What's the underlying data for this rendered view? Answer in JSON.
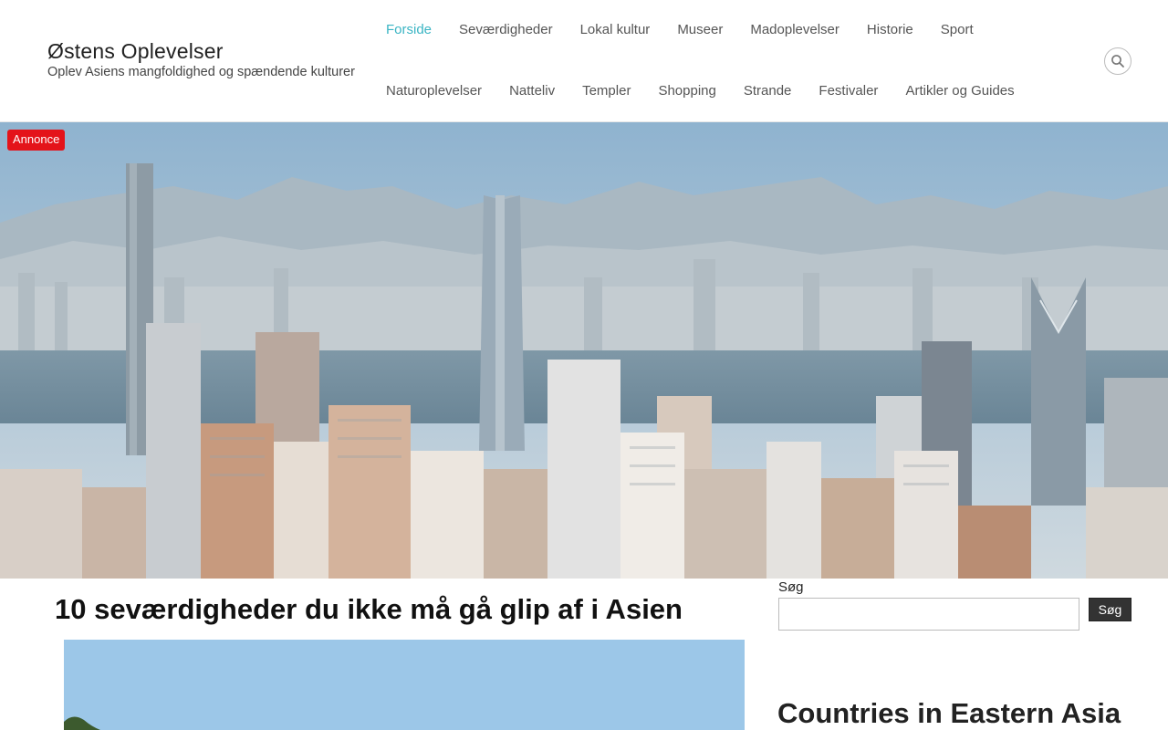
{
  "header": {
    "site_title": "Østens Oplevelser",
    "tagline": "Oplev Asiens mangfoldighed og spændende kulturer",
    "nav_row1": [
      "Forside",
      "Seværdigheder",
      "Lokal kultur",
      "Museer",
      "Madoplevelser",
      "Historie",
      "Sport"
    ],
    "nav_row2": [
      "Naturoplevelser",
      "Natteliv",
      "Templer",
      "Shopping",
      "Strande",
      "Festivaler",
      "Artikler og Guides"
    ],
    "active_item": "Forside",
    "search_icon": "search-icon"
  },
  "hero": {
    "ad_label": "Annonce",
    "image_subject": "city-skyline"
  },
  "main": {
    "post_title": "10 seværdigheder du ikke må gå glip af i Asien"
  },
  "sidebar": {
    "search_label": "Søg",
    "search_value": "",
    "search_button": "Søg",
    "widget_title": "Countries in Eastern Asia"
  },
  "colors": {
    "accent": "#3bb5c4",
    "ad_badge": "#e4131a",
    "button_bg": "#333333"
  }
}
